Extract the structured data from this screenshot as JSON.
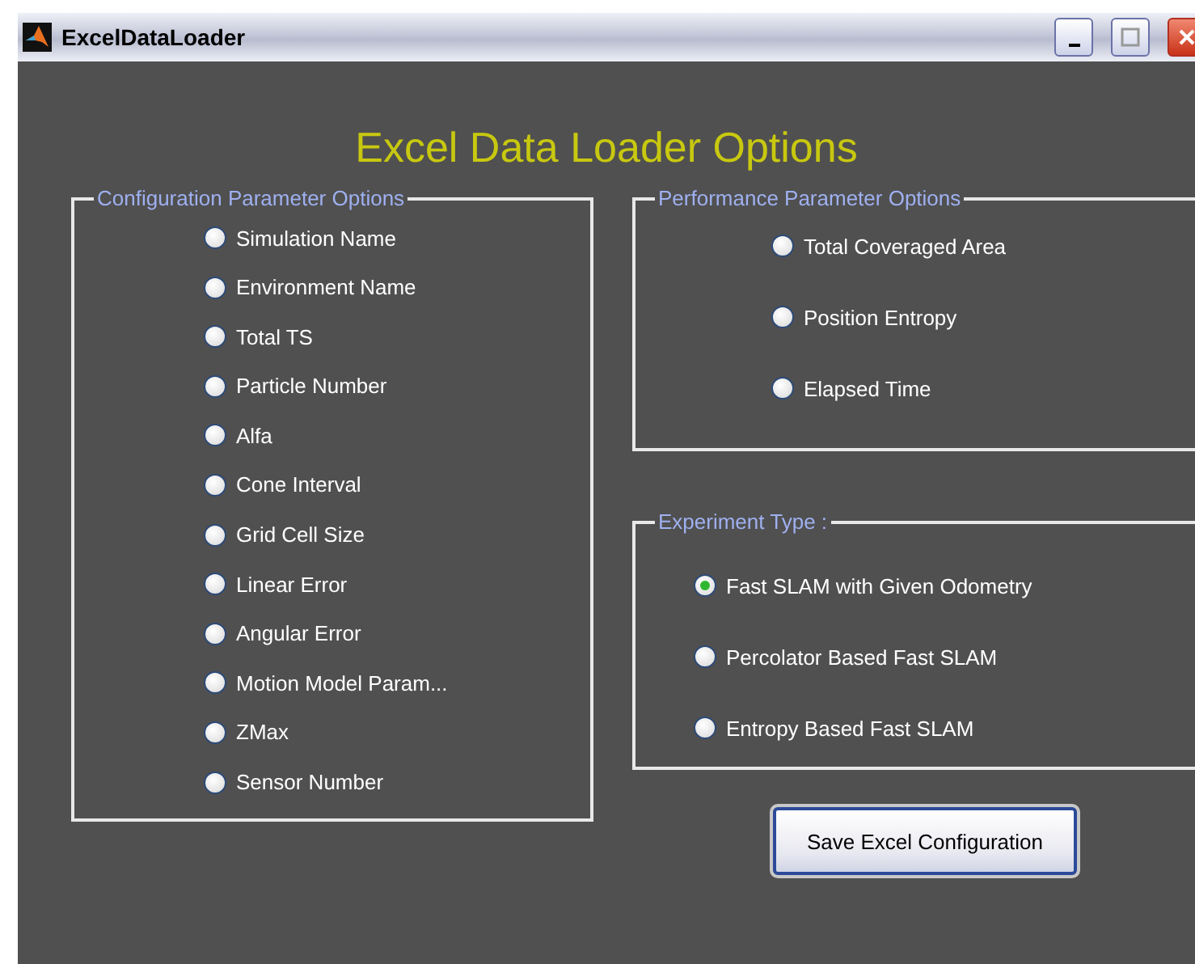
{
  "window": {
    "title": "ExcelDataLoader"
  },
  "heading": "Excel Data Loader Options",
  "groups": [
    {
      "label": "Configuration Parameter Options",
      "kind": "config",
      "options": [
        {
          "label": "Simulation Name",
          "selected": false
        },
        {
          "label": "Environment Name",
          "selected": false
        },
        {
          "label": "Total TS",
          "selected": false
        },
        {
          "label": "Particle Number",
          "selected": false
        },
        {
          "label": "Alfa",
          "selected": false
        },
        {
          "label": "Cone Interval",
          "selected": false
        },
        {
          "label": "Grid Cell Size",
          "selected": false
        },
        {
          "label": "Linear Error",
          "selected": false
        },
        {
          "label": "Angular Error",
          "selected": false
        },
        {
          "label": "Motion Model Param...",
          "selected": false
        },
        {
          "label": "ZMax",
          "selected": false
        },
        {
          "label": "Sensor Number",
          "selected": false
        }
      ]
    },
    {
      "label": "Performance Parameter Options",
      "kind": "performance",
      "options": [
        {
          "label": "Total Coveraged Area",
          "selected": false
        },
        {
          "label": "Position Entropy",
          "selected": false
        },
        {
          "label": "Elapsed Time",
          "selected": false
        }
      ]
    },
    {
      "label": "Experiment Type :",
      "kind": "experiment",
      "options": [
        {
          "label": "Fast SLAM with Given Odometry",
          "selected": true
        },
        {
          "label": "Percolator Based Fast SLAM",
          "selected": false
        },
        {
          "label": "Entropy Based Fast SLAM",
          "selected": false
        }
      ]
    }
  ],
  "button": "Save Excel Configuration"
}
